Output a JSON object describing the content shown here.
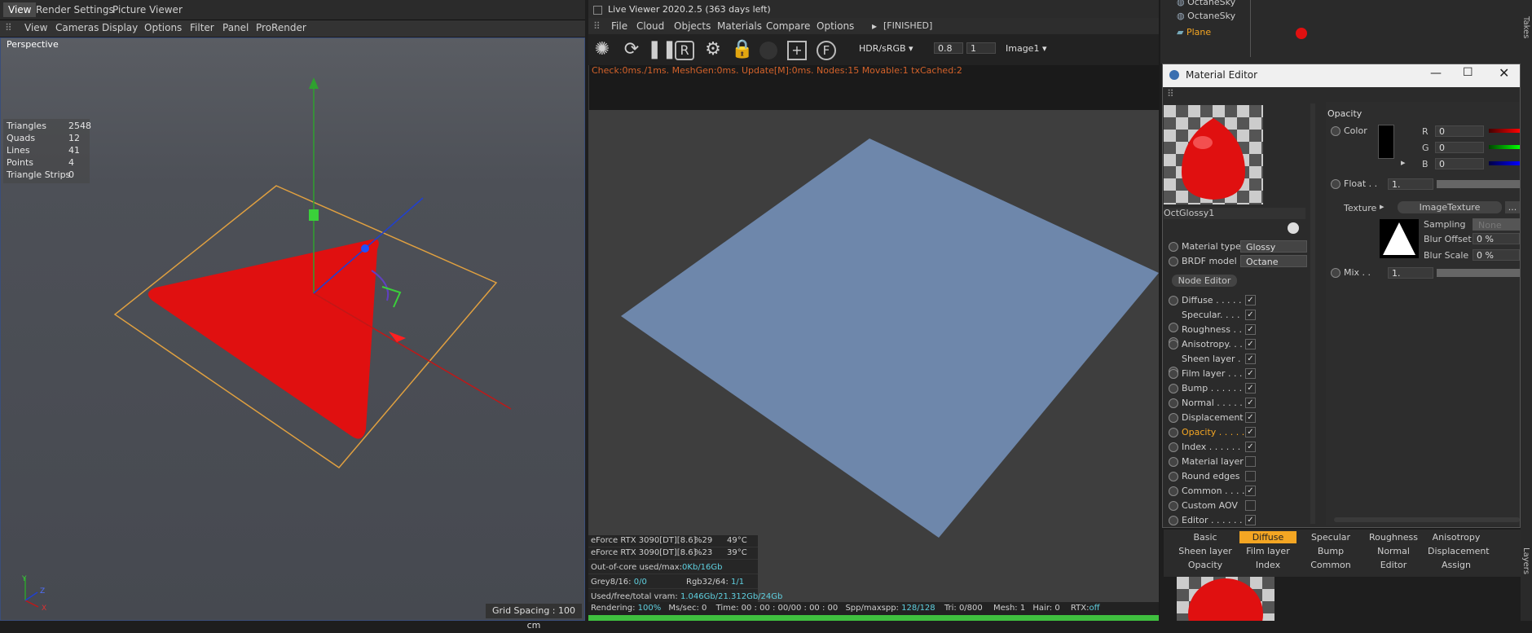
{
  "viewport": {
    "tabs": [
      "View",
      "Render Settings",
      "Picture Viewer"
    ],
    "menu": [
      "View",
      "Cameras",
      "Display",
      "Options",
      "Filter",
      "Panel",
      "ProRender"
    ],
    "label": "Perspective",
    "stats": [
      {
        "k": "Triangles",
        "v": "2548"
      },
      {
        "k": "Quads",
        "v": "12"
      },
      {
        "k": "Lines",
        "v": "41"
      },
      {
        "k": "Points",
        "v": "4"
      },
      {
        "k": "Triangle Strips",
        "v": "0"
      }
    ],
    "grid_spacing": "Grid Spacing : 100 cm",
    "axis_labels": {
      "x": "X",
      "y": "Y",
      "z": "Z"
    }
  },
  "live_viewer": {
    "title": "Live Viewer 2020.2.5 (363 days left)",
    "menu": [
      "File",
      "Cloud",
      "Objects",
      "Materials",
      "Compare",
      "Options"
    ],
    "state": "[FINISHED]",
    "colorspace": "HDR/sRGB",
    "exposure": "0.8",
    "gamma": "1",
    "image": "Image1",
    "status": "Check:0ms./1ms. MeshGen:0ms. Update[M]:0ms. Nodes:15 Movable:1 txCached:2",
    "gpus": [
      {
        "name": "eForce RTX 3090[DT][8.6]",
        "usage": "%29",
        "temp": "49°C"
      },
      {
        "name": "eForce RTX 3090[DT][8.6]",
        "usage": "%23",
        "temp": "39°C"
      }
    ],
    "ooc_label": "Out-of-core used/max:",
    "ooc_value": "0Kb/16Gb",
    "grey_label": "Grey8/16:",
    "grey_value": "0/0",
    "rgb_label": "Rgb32/64:",
    "rgb_value": "1/1",
    "vram_label": "Used/free/total vram:",
    "vram_value": "1.046Gb/21.312Gb/24Gb",
    "bottom": {
      "rendering_label": "Rendering:",
      "rendering_value": "100%",
      "ms_label": "Ms/sec:",
      "ms_value": "0",
      "time_label": "Time:",
      "time_value": "00 : 00 : 00/00 : 00 : 00",
      "spp_label": "Spp/maxspp:",
      "spp_value": "128/128",
      "tri_label": "Tri:",
      "tri_value": "0/800",
      "mesh_label": "Mesh:",
      "mesh_value": "1",
      "hair_label": "Hair:",
      "hair_value": "0",
      "rtx_label": "RTX:",
      "rtx_value": "off"
    },
    "progress": 1.0
  },
  "object_manager": {
    "rows": [
      "OctaneSky",
      "OctaneSky",
      "Plane"
    ]
  },
  "material_editor": {
    "title": "Material Editor",
    "material_name": "OctGlossy1",
    "material_type_label": "Material type",
    "material_type": "Glossy",
    "brdf_label": "BRDF model",
    "brdf": "Octane",
    "node_editor": "Node Editor",
    "channels": [
      {
        "label": "Diffuse . . . . .",
        "checked": true
      },
      {
        "label": "Specular. . . . .",
        "checked": true
      },
      {
        "label": "Roughness . . .",
        "checked": true
      },
      {
        "label": "Anisotropy. . .",
        "checked": true
      },
      {
        "label": "Sheen layer . .",
        "checked": true
      },
      {
        "label": "Film layer . . .",
        "checked": true
      },
      {
        "label": "Bump . . . . . .",
        "checked": true
      },
      {
        "label": "Normal . . . . .",
        "checked": true
      },
      {
        "label": "Displacement",
        "checked": true
      },
      {
        "label": "Opacity . . . . .",
        "checked": true,
        "active": true
      },
      {
        "label": "Index . . . . . .",
        "checked": true
      },
      {
        "label": "Material layer",
        "checked": false
      },
      {
        "label": "Round edges",
        "checked": false
      },
      {
        "label": "Common . . . .",
        "checked": true
      },
      {
        "label": "Custom AOV",
        "checked": false
      },
      {
        "label": "Editor . . . . . .",
        "checked": true
      }
    ],
    "section": "Opacity",
    "color_label": "Color",
    "r": "0",
    "g": "0",
    "b": "0",
    "float_label": "Float . .",
    "float_value": "1.",
    "texture_label": "Texture",
    "texture_name": "ImageTexture",
    "sampling_label": "Sampling",
    "sampling_value": "None",
    "blur_offset_label": "Blur Offset",
    "blur_offset_value": "0 %",
    "blur_scale_label": "Blur Scale",
    "blur_scale_value": "0 %",
    "mix_label": "Mix . .",
    "mix_value": "1.",
    "tabs": [
      [
        "Basic",
        "Diffuse",
        "Specular",
        "Roughness",
        "Anisotropy"
      ],
      [
        "Sheen layer",
        "Film layer",
        "Bump",
        "Normal",
        "Displacement"
      ],
      [
        "Opacity",
        "Index",
        "Common",
        "Editor",
        "Assign"
      ]
    ],
    "active_tab": "Diffuse"
  },
  "side_labels": [
    "Takes",
    "Layers"
  ],
  "colors": {
    "accent": "#f4a623",
    "status": "#d4622a",
    "progress": "#3fbf3f",
    "render_plane": "#6e87ab",
    "object_red": "#e01010"
  }
}
